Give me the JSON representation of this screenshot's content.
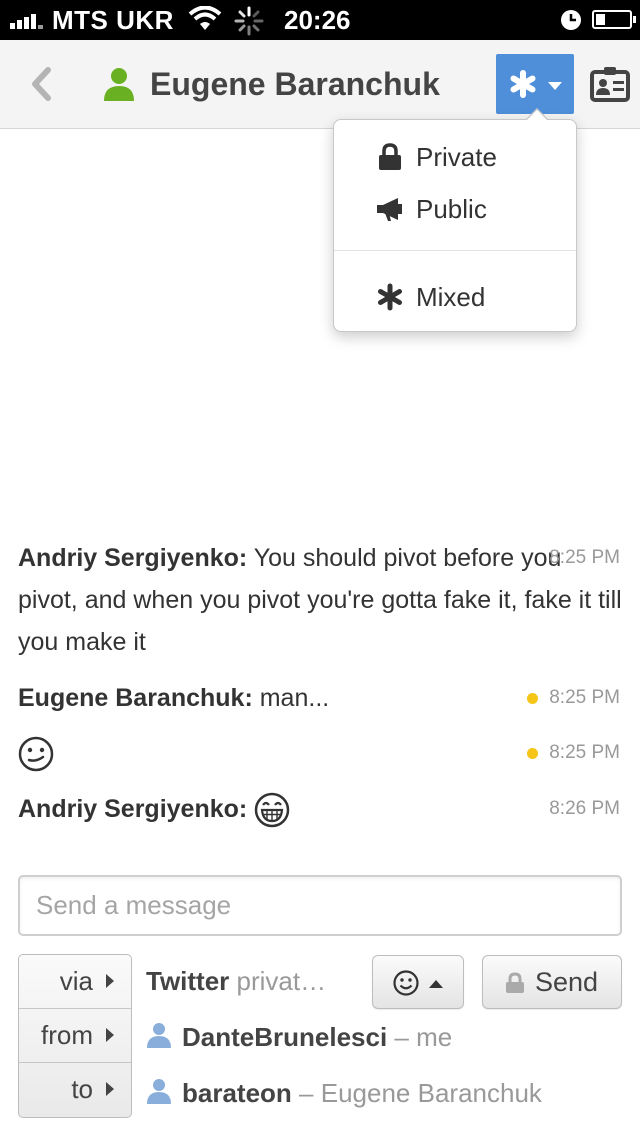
{
  "status_bar": {
    "carrier": "MTS UKR",
    "time": "20:26",
    "icons": [
      "signal-icon",
      "wifi-icon",
      "activity-spinner-icon",
      "alarm-clock-icon",
      "battery-icon"
    ]
  },
  "nav": {
    "back_icon": "chevron-left-icon",
    "title": "Eugene Baranchuk",
    "title_icon": "person-icon",
    "mode_icon": "asterisk-icon",
    "contact_icon": "contact-card-icon",
    "accent_color": "#4f8ed8",
    "person_color": "#6ab023"
  },
  "mode_menu": {
    "items": [
      {
        "label": "Private",
        "icon": "lock-icon"
      },
      {
        "label": "Public",
        "icon": "megaphone-icon"
      },
      {
        "label": "Mixed",
        "icon": "asterisk-icon"
      }
    ]
  },
  "messages": [
    {
      "sender": "Andriy Sergiyenko:",
      "text": "You should pivot before you pivot, and when you pivot you're gotta fake it, fake it till you make it",
      "time": "8:25 PM",
      "unread": false
    },
    {
      "sender": "Eugene Baranchuk:",
      "text": "man...",
      "time": "8:25 PM",
      "unread": true
    },
    {
      "sender": "",
      "text": "",
      "emoji": "smiley-face-icon",
      "time": "8:25 PM",
      "unread": true
    },
    {
      "sender": "Andriy Sergiyenko:",
      "text": "",
      "emoji": "grinning-face-icon",
      "time": "8:26 PM",
      "unread": false
    }
  ],
  "unread_dot_color": "#f5c518",
  "composer": {
    "placeholder": "Send a message",
    "value": ""
  },
  "route": {
    "via": {
      "label": "via",
      "service": "Twitter",
      "visibility": "privat…"
    },
    "from": {
      "label": "from",
      "account": "DanteBrunelesci",
      "separator": "–",
      "note": "me"
    },
    "to": {
      "label": "to",
      "account": "barateon",
      "separator": "–",
      "note": "Eugene Baranchuk"
    }
  },
  "buttons": {
    "emoji_icon": "smiley-face-icon",
    "send_label": "Send",
    "send_icon": "lock-icon"
  }
}
